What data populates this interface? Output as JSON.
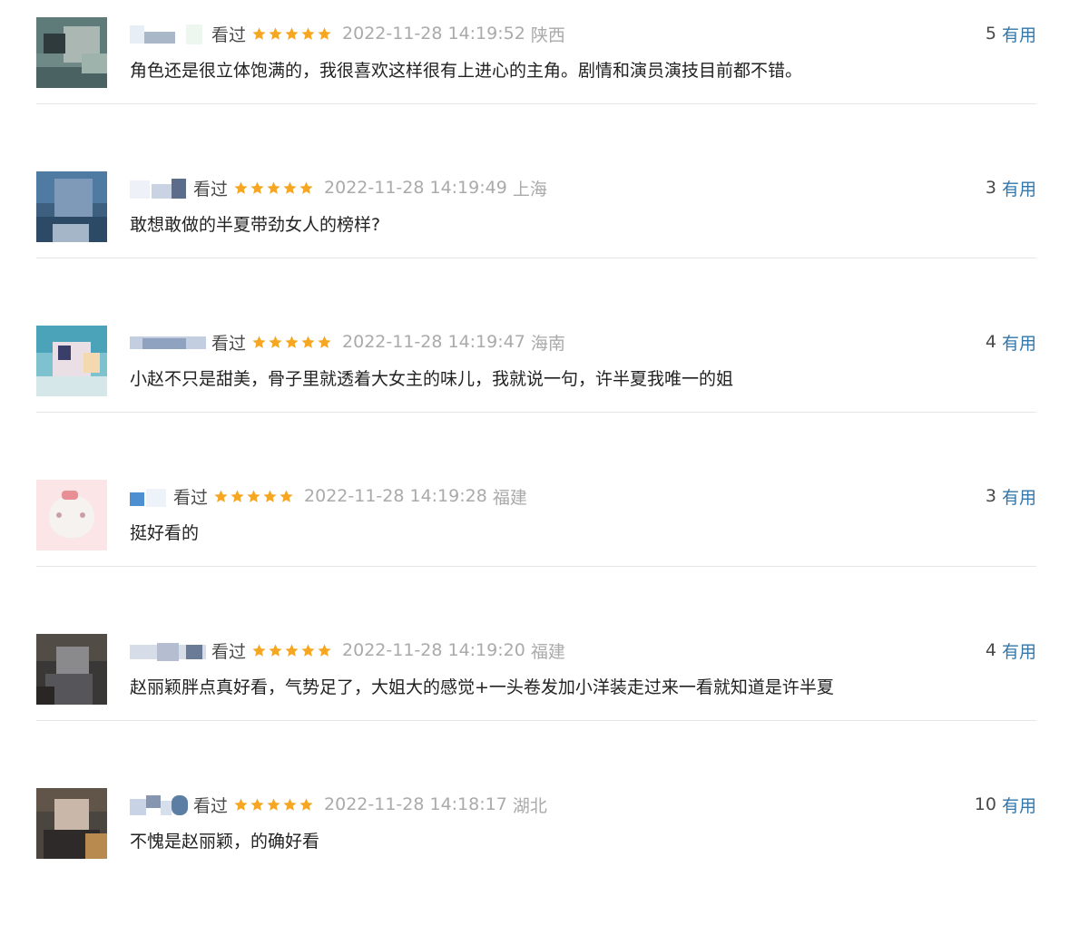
{
  "accent_color": "#3377aa",
  "star_color": "#f5a623",
  "comments": [
    {
      "status": "看过",
      "rating_stars": 5,
      "time": "2022-11-28 14:19:52",
      "location": "陕西",
      "votes": "5",
      "useful_label": "有用",
      "text": "角色还是很立体饱满的，我很喜欢这样很有上进心的主角。剧情和演员演技目前都不错。"
    },
    {
      "status": "看过",
      "rating_stars": 5,
      "time": "2022-11-28 14:19:49",
      "location": "上海",
      "votes": "3",
      "useful_label": "有用",
      "text": "敢想敢做的半夏带劲女人的榜样?"
    },
    {
      "status": "看过",
      "rating_stars": 5,
      "time": "2022-11-28 14:19:47",
      "location": "海南",
      "votes": "4",
      "useful_label": "有用",
      "text": "小赵不只是甜美，骨子里就透着大女主的味儿，我就说一句，许半夏我唯一的姐"
    },
    {
      "status": "看过",
      "rating_stars": 5,
      "time": "2022-11-28 14:19:28",
      "location": "福建",
      "votes": "3",
      "useful_label": "有用",
      "text": "挺好看的"
    },
    {
      "status": "看过",
      "rating_stars": 5,
      "time": "2022-11-28 14:19:20",
      "location": "福建",
      "votes": "4",
      "useful_label": "有用",
      "text": "赵丽颖胖点真好看，气势足了，大姐大的感觉+一头卷发加小洋装走过来一看就知道是许半夏"
    },
    {
      "status": "看过",
      "rating_stars": 5,
      "time": "2022-11-28 14:18:17",
      "location": "湖北",
      "votes": "10",
      "useful_label": "有用",
      "text": "不愧是赵丽颖，的确好看"
    }
  ]
}
